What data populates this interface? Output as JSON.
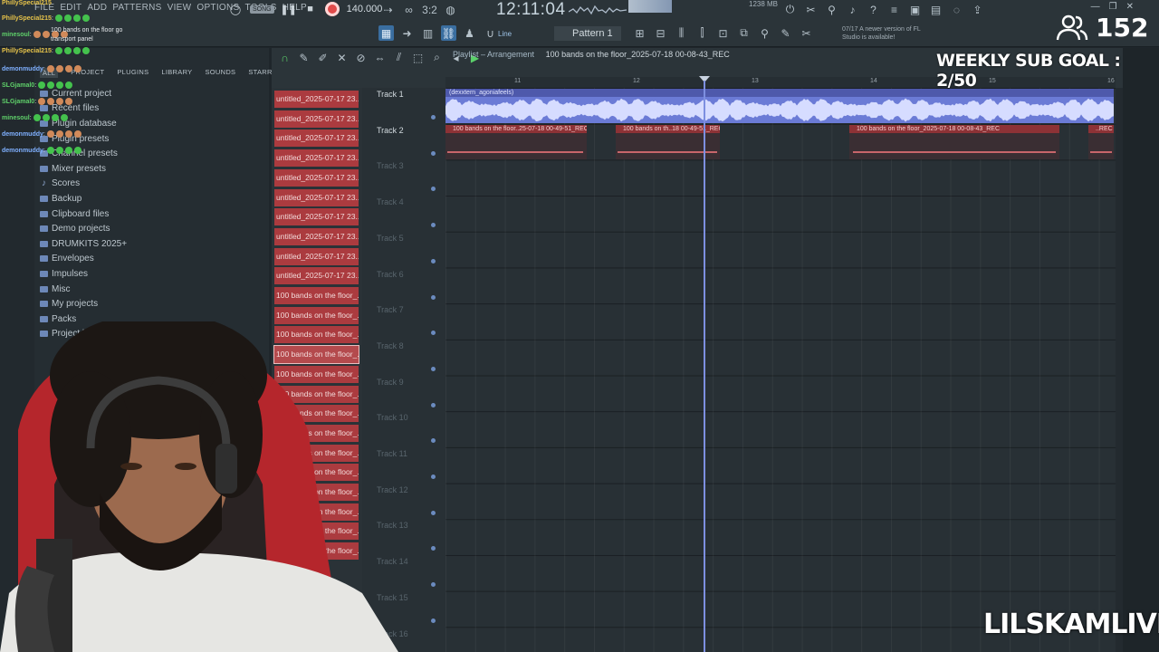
{
  "menu": [
    "FILE",
    "EDIT",
    "ADD",
    "PATTERNS",
    "VIEW",
    "OPTIONS",
    "TOOLS",
    "HELP"
  ],
  "transport": {
    "mode_tag": "SONG",
    "bpm": "140.000",
    "clock": "12:11:04",
    "memory": "1238 MB"
  },
  "toolbar": {
    "pattern": "Pattern 1",
    "snap": "Line",
    "notice_date": "07/17",
    "notice_text": "A newer version of FL Studio is available!"
  },
  "browser": {
    "tabs": [
      "ALL",
      "PROJECT",
      "PLUGINS",
      "LIBRARY",
      "SOUNDS",
      "STARRED"
    ],
    "items": [
      {
        "label": "Current project",
        "icon": "folder-icon"
      },
      {
        "label": "Recent files",
        "icon": "folder-icon"
      },
      {
        "label": "Plugin database",
        "icon": "folder-icon"
      },
      {
        "label": "Plugin presets",
        "icon": "folder-icon"
      },
      {
        "label": "Channel presets",
        "icon": "folder-icon"
      },
      {
        "label": "Mixer presets",
        "icon": "folder-icon"
      },
      {
        "label": "Scores",
        "icon": "note-icon"
      },
      {
        "label": "Backup",
        "icon": "folder-icon"
      },
      {
        "label": "Clipboard files",
        "icon": "folder-icon"
      },
      {
        "label": "Demo projects",
        "icon": "folder-icon"
      },
      {
        "label": "DRUMKITS 2025+",
        "icon": "folder-icon"
      },
      {
        "label": "Envelopes",
        "icon": "folder-icon"
      },
      {
        "label": "Impulses",
        "icon": "folder-icon"
      },
      {
        "label": "Misc",
        "icon": "folder-icon"
      },
      {
        "label": "My projects",
        "icon": "folder-icon"
      },
      {
        "label": "Packs",
        "icon": "folder-icon"
      },
      {
        "label": "Project bo",
        "icon": "folder-icon"
      }
    ]
  },
  "chat": [
    {
      "user": "PhillySpecial215",
      "msg": "",
      "color": "#e6c34a"
    },
    {
      "user": "PhillySpecial215",
      "msg": ":",
      "color": "#e6c34a"
    },
    {
      "user": "minesoul",
      "msg": ":",
      "color": "#5fd06a"
    },
    {
      "user": "",
      "msg": "100 bands on the floor go",
      "color": "#e5e9ec"
    },
    {
      "user": "",
      "msg": "transport panel",
      "color": "#e5e9ec"
    },
    {
      "user": "PhillySpecial215",
      "msg": ":",
      "color": "#e6c34a"
    },
    {
      "user": "demonmuddy",
      "msg": ":",
      "color": "#7fb0ff"
    },
    {
      "user": "SLGjamal0",
      "msg": ":",
      "color": "#5fd06a"
    },
    {
      "user": "SLGjamal0",
      "msg": ":",
      "color": "#5fd06a"
    },
    {
      "user": "minesoul",
      "msg": ":",
      "color": "#5fd06a"
    },
    {
      "user": "demonmuddy",
      "msg": ":",
      "color": "#7fb0ff"
    },
    {
      "user": "demonmuddy",
      "msg": ":",
      "color": "#7fb0ff"
    }
  ],
  "clips": [
    "untitled_2025-07-17 23...",
    "untitled_2025-07-17 23...",
    "untitled_2025-07-17 23...",
    "untitled_2025-07-17 23...",
    "untitled_2025-07-17 23...",
    "untitled_2025-07-17 23...",
    "untitled_2025-07-17 23...",
    "untitled_2025-07-17 23...",
    "untitled_2025-07-17 23...",
    "untitled_2025-07-17 23...",
    "100 bands on the floor_...",
    "100 bands on the floor_...",
    "100 bands on the floor_...",
    "100 bands on the floor_...",
    "100 bands on the floor_...",
    "100 bands on the floor_...",
    "100 bands on the floor_...",
    "100 bands on the floor_...",
    "100 bands on the floor_...",
    "100 bands on the floor_...",
    "100 bands on the floor_...",
    "100 bands on the floor_...",
    "100 bands on the floor_...",
    "100 bands on the floor_..."
  ],
  "playlist": {
    "title": "Playlist",
    "subtitle": "Arrangement",
    "project": "100 bands on the floor_2025-07-18 00-08-43_REC",
    "ruler": [
      "11",
      "12",
      "13",
      "14",
      "15",
      "16"
    ],
    "tracks": [
      "Track 1",
      "Track 2",
      "Track 3",
      "Track 4",
      "Track 5",
      "Track 6",
      "Track 7",
      "Track 8",
      "Track 9",
      "Track 10",
      "Track 11",
      "Track 12",
      "Track 13",
      "Track 14",
      "Track 15",
      "Track 16"
    ],
    "track1_clip": "(dexxtern_agoniafeels)",
    "track2_clips": [
      "100 bands on the floor..25-07-18 00-49-51_REC",
      "100 bands on th..18 00-49-51_REC",
      "100 bands on the floor_2025-07-18 00-08-43_REC",
      "..REC"
    ]
  },
  "stream": {
    "viewers": "152",
    "sub_goal": "WEEKLY SUB GOAL : 2/50",
    "brand": "LILSKAMLIVE"
  },
  "colors": {
    "accent": "#6b7bd6",
    "clip_red": "#ab3b3f",
    "record": "#e04a4a"
  }
}
